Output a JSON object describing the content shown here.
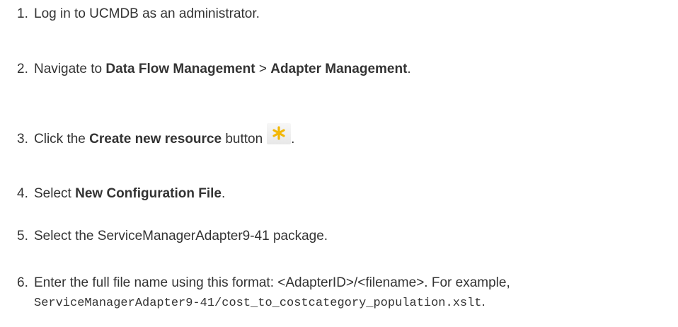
{
  "steps": [
    {
      "num": "1.",
      "text": "Log in to UCMDB as an administrator."
    },
    {
      "num": "2.",
      "prefix": "Navigate to ",
      "bold1": "Data Flow Management",
      "sep": " > ",
      "bold2": "Adapter Management",
      "suffix": "."
    },
    {
      "num": "3.",
      "prefix": "Click the ",
      "bold": "Create new resource",
      "mid": " button",
      "suffix": ".",
      "icon": "asterisk-create-icon"
    },
    {
      "num": "4.",
      "prefix": "Select ",
      "bold": "New Configuration File",
      "suffix": "."
    },
    {
      "num": "5.",
      "text": "Select the ServiceManagerAdapter9-41 package."
    },
    {
      "num": "6.",
      "text": "Enter the full file name using this format: <AdapterID>/<filename>. For example,",
      "code": "ServiceManagerAdapter9-41/cost_to_costcategory_population.xslt",
      "suffix": "."
    }
  ],
  "colors": {
    "text": "#333333",
    "icon_star": "#f2b705",
    "background": "#ffffff"
  }
}
